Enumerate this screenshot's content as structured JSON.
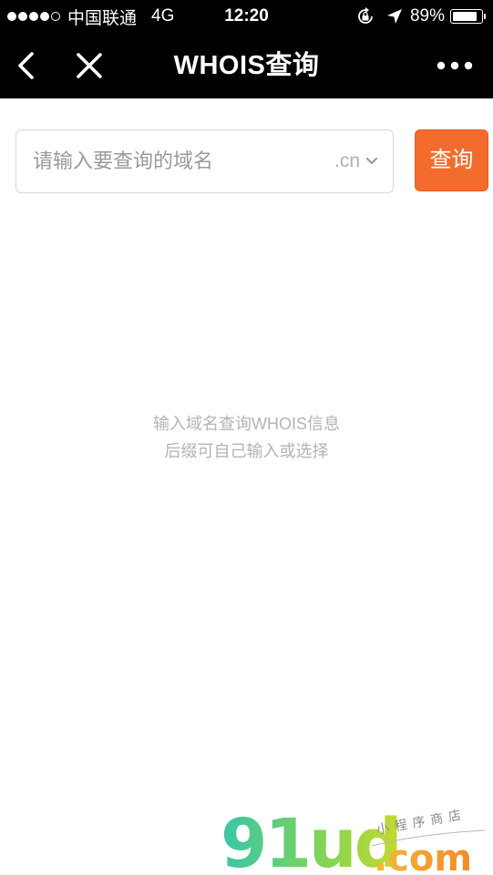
{
  "status_bar": {
    "carrier": "中国联通",
    "network": "4G",
    "time": "12:20",
    "battery_percent": "89%",
    "battery_level": 0.89,
    "signal_bars_filled": 4,
    "signal_bars_total": 5,
    "icons": [
      "rotation-lock-icon",
      "location-arrow-icon",
      "battery-icon"
    ]
  },
  "nav": {
    "title": "WHOIS查询",
    "icons": [
      "back-arrow-icon",
      "close-icon",
      "more-dots-icon"
    ]
  },
  "search": {
    "placeholder": "请输入要查询的域名",
    "value": "",
    "suffix": ".cn",
    "button_label": "查询"
  },
  "hint": {
    "line1": "输入域名查询WHOIS信息",
    "line2": "后缀可自己输入或选择"
  },
  "watermark": {
    "brand": "91ud",
    "domain_suffix": ".com",
    "tagline": "小程序商店"
  },
  "colors": {
    "accent": "#f46c2d",
    "nav_background": "#000000",
    "hint_text": "#b3b3b3",
    "placeholder_text": "#9a9a9a"
  }
}
